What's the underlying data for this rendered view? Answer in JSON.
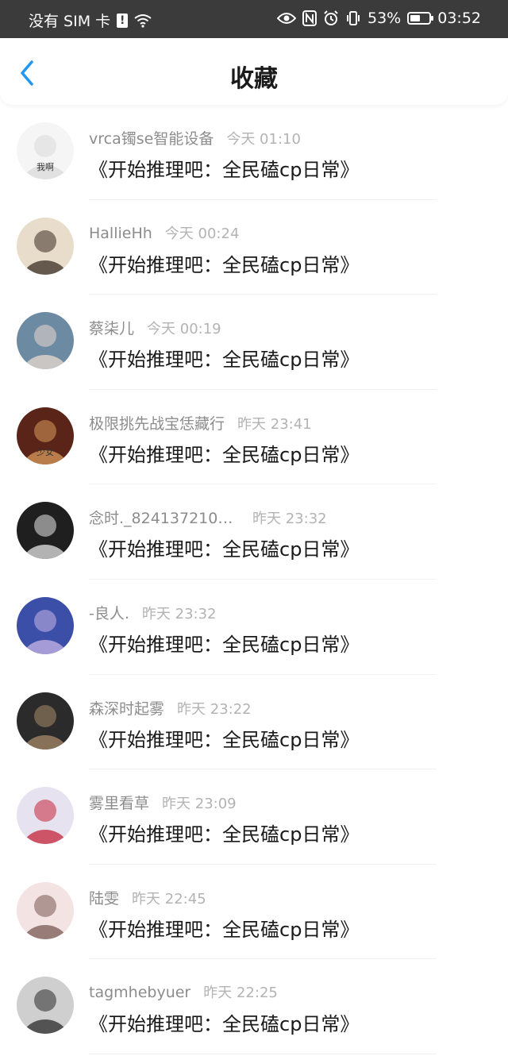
{
  "status_bar": {
    "carrier": "没有 SIM 卡",
    "sim_alert": "!",
    "battery_percent": "53%",
    "battery_level": 0.53,
    "time": "03:52",
    "icons": [
      "wifi-icon",
      "eye-icon",
      "nfc-icon",
      "alarm-icon",
      "vibrate-icon",
      "battery-icon"
    ]
  },
  "header": {
    "title": "收藏",
    "back_icon": "chevron-left-icon",
    "accent_color": "#2196f3"
  },
  "items": [
    {
      "username": "vrca镯se智能设备",
      "time": "今天 01:10",
      "title": "《开始推理吧：全民磕cp日常》",
      "avatar_colors": [
        "#f5f5f5",
        "#d9d9d9"
      ],
      "avatar_label": "我啊"
    },
    {
      "username": "HallieHh",
      "time": "今天 00:24",
      "title": "《开始推理吧：全民磕cp日常》",
      "avatar_colors": [
        "#e8dccb",
        "#3a2d24"
      ]
    },
    {
      "username": "蔡柒儿",
      "time": "今天 00:19",
      "title": "《开始推理吧：全民磕cp日常》",
      "avatar_colors": [
        "#6d8aa3",
        "#e9d9cf"
      ]
    },
    {
      "username": "极限挑先战宝恁藏行",
      "time": "昨天 23:41",
      "title": "《开始推理吧：全民磕cp日常》",
      "avatar_colors": [
        "#5a2418",
        "#d99a5c"
      ],
      "avatar_label": "少女"
    },
    {
      "username": "念时._8241372101...",
      "time": "昨天 23:32",
      "title": "《开始推理吧：全民磕cp日常》",
      "avatar_colors": [
        "#1f1f1f",
        "#e6e6e6"
      ]
    },
    {
      "username": "-良人.",
      "time": "昨天 23:32",
      "title": "《开始推理吧：全民磕cp日常》",
      "avatar_colors": [
        "#3b4ea8",
        "#c9b6e6"
      ]
    },
    {
      "username": "森深时起雾",
      "time": "昨天 23:22",
      "title": "《开始推理吧：全民磕cp日常》",
      "avatar_colors": [
        "#2b2b2b",
        "#a88a6a"
      ]
    },
    {
      "username": "雾里看草",
      "time": "昨天 23:09",
      "title": "《开始推理吧：全民磕cp日常》",
      "avatar_colors": [
        "#e7e2ef",
        "#c4243a"
      ]
    },
    {
      "username": "陆雯",
      "time": "昨天 22:45",
      "title": "《开始推理吧：全民磕cp日常》",
      "avatar_colors": [
        "#f3e3e3",
        "#7a5a54"
      ]
    },
    {
      "username": "tagmhebyuer",
      "time": "昨天 22:25",
      "title": "《开始推理吧：全民磕cp日常》",
      "avatar_colors": [
        "#cfcfcf",
        "#2a2a2a"
      ]
    }
  ]
}
